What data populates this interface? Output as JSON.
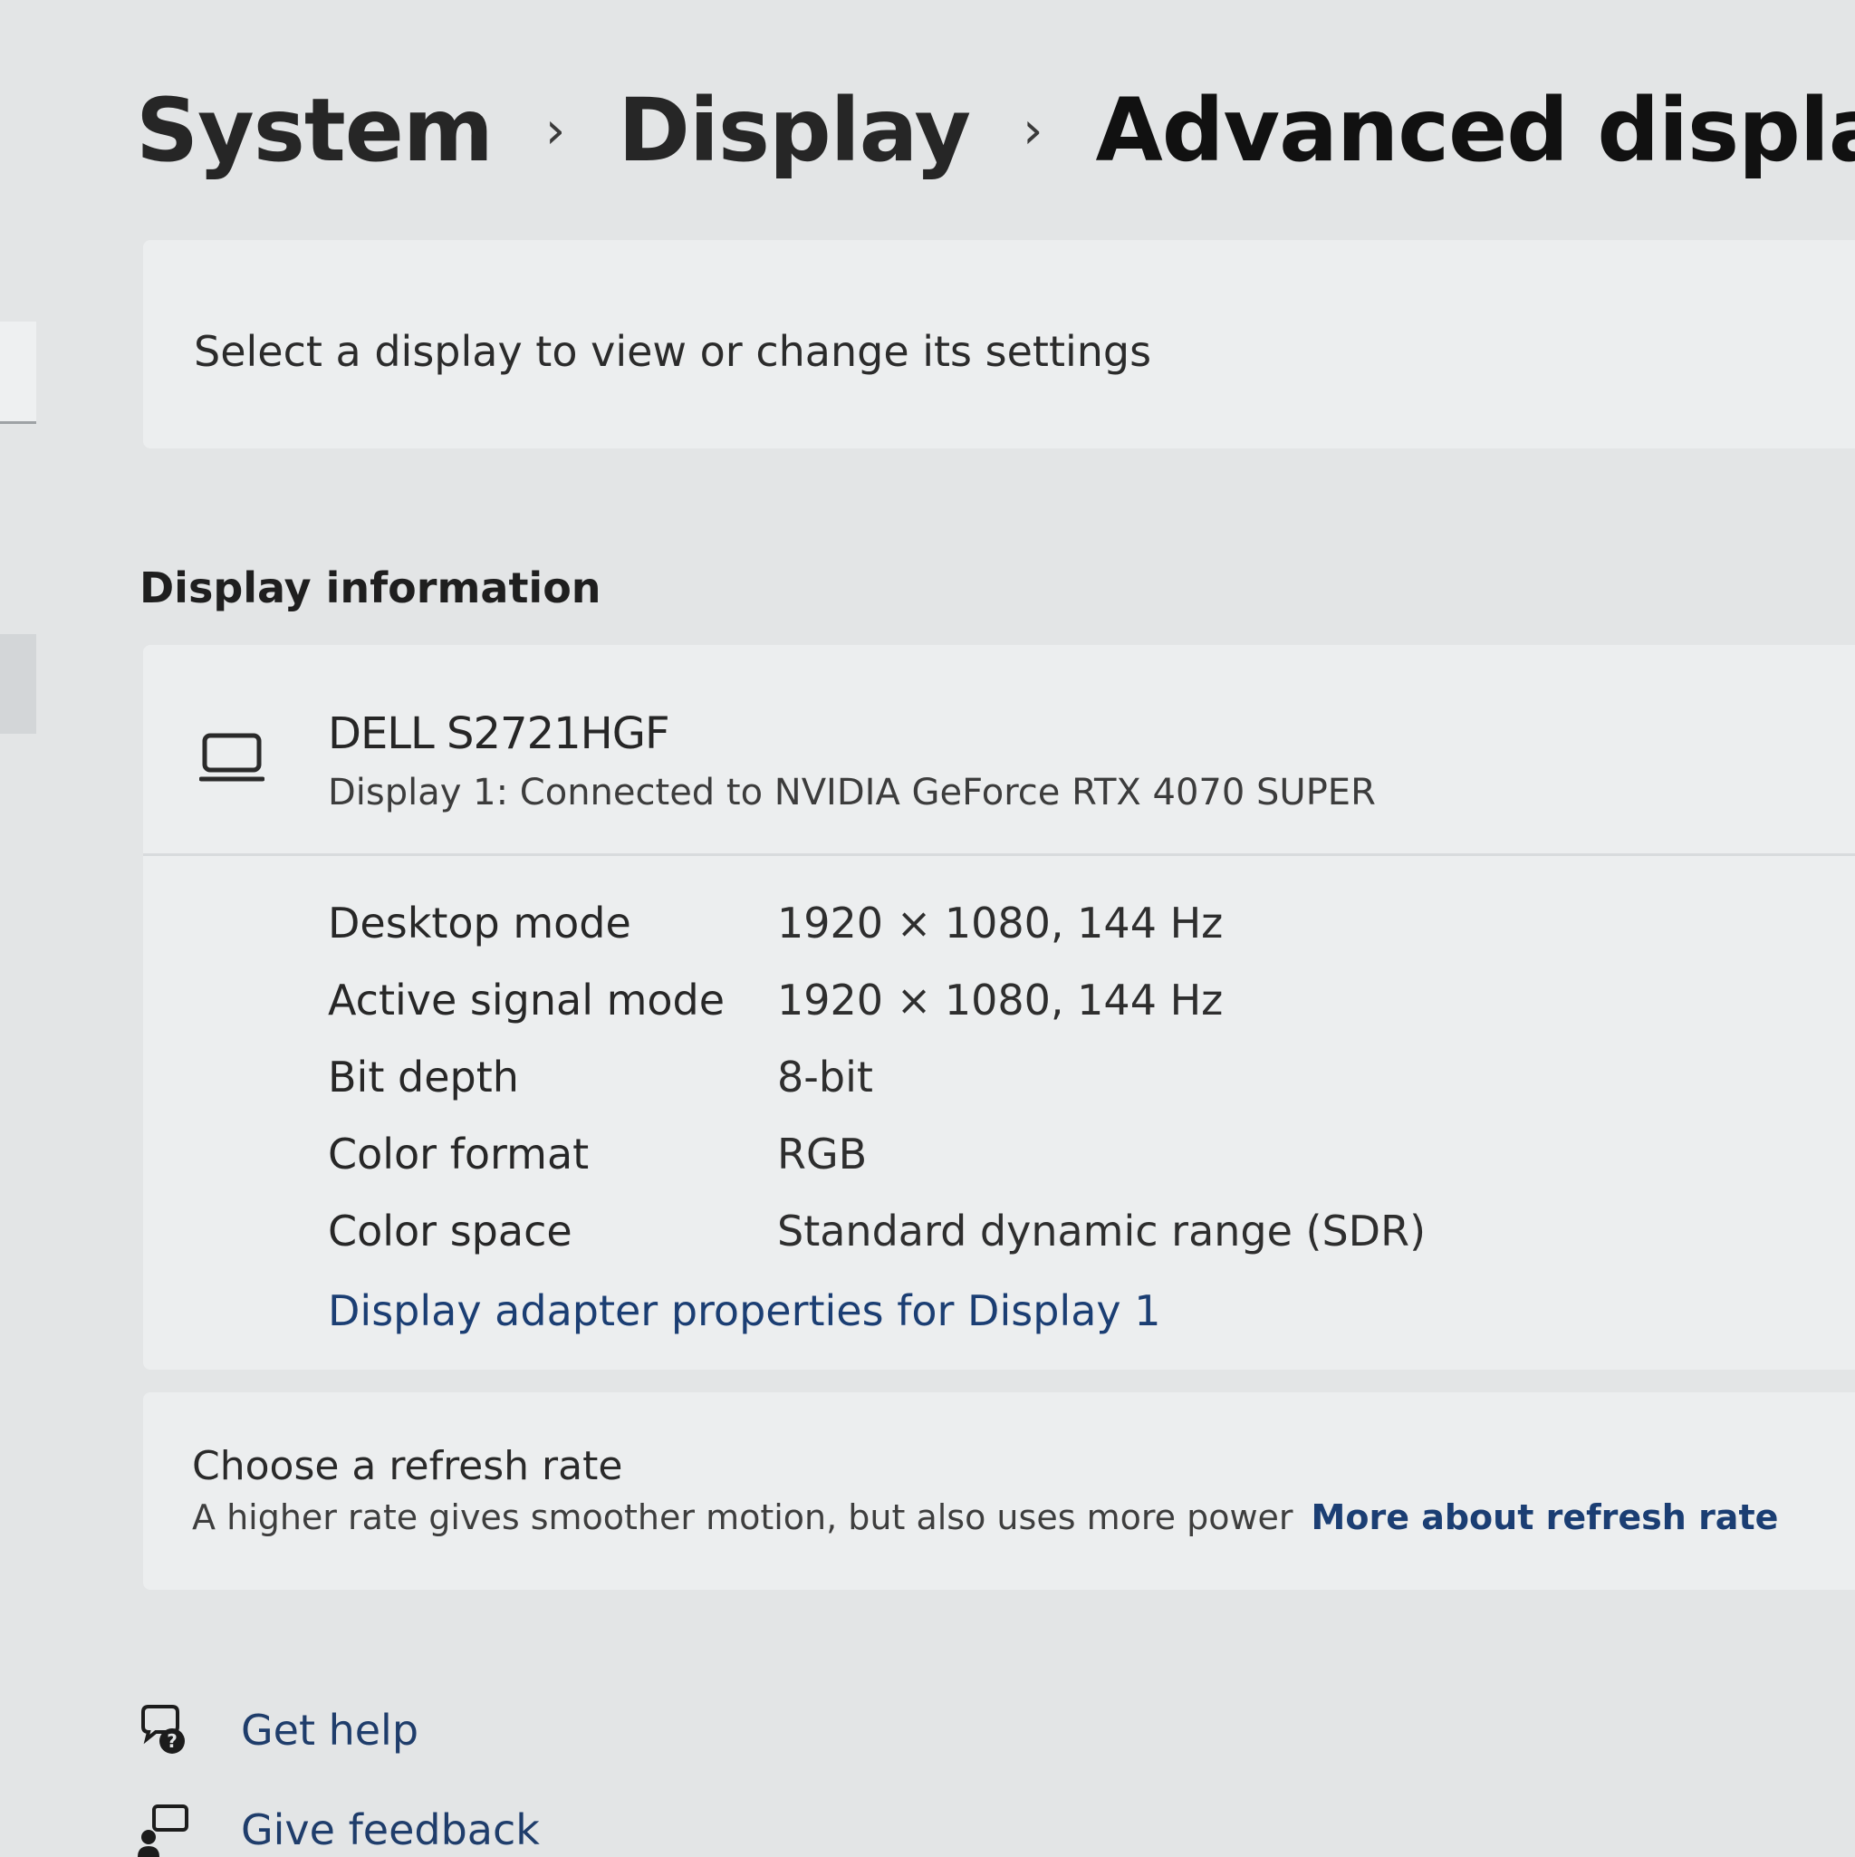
{
  "breadcrumb": {
    "items": [
      "System",
      "Display",
      "Advanced display"
    ],
    "separator": "›"
  },
  "select_display": {
    "label": "Select a display to view or change its settings"
  },
  "display_information": {
    "heading": "Display information",
    "monitor_name": "DELL S2721HGF",
    "monitor_subtitle": "Display 1: Connected to NVIDIA GeForce RTX 4070 SUPER",
    "rows": [
      {
        "label": "Desktop mode",
        "value": "1920 × 1080, 144 Hz"
      },
      {
        "label": "Active signal mode",
        "value": "1920 × 1080, 144 Hz"
      },
      {
        "label": "Bit depth",
        "value": "8-bit"
      },
      {
        "label": "Color format",
        "value": "RGB"
      },
      {
        "label": "Color space",
        "value": "Standard dynamic range (SDR)"
      }
    ],
    "adapter_link": "Display adapter properties for Display 1"
  },
  "refresh_rate": {
    "title": "Choose a refresh rate",
    "description": "A higher rate gives smoother motion, but also uses more power",
    "link": "More about refresh rate"
  },
  "footer": {
    "get_help": "Get help",
    "give_feedback": "Give feedback"
  },
  "icons": {
    "monitor": "monitor-icon",
    "help": "help-icon",
    "feedback": "feedback-icon"
  },
  "colors": {
    "link": "#1b3e73",
    "background": "#e3e5e6",
    "card": "#eceeef"
  }
}
